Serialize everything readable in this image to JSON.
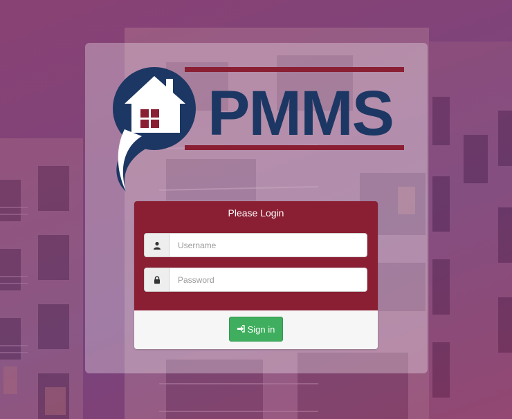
{
  "logo": {
    "text": "PMMS"
  },
  "login": {
    "title": "Please Login",
    "username_placeholder": "Username",
    "password_placeholder": "Password",
    "signin_label": "Sign in"
  },
  "colors": {
    "brand_navy": "#1c3763",
    "brand_red": "#8a1e32",
    "button_green": "#3fae5e"
  },
  "icons": {
    "username": "user-icon",
    "password": "lock-icon",
    "signin": "sign-in-icon"
  }
}
